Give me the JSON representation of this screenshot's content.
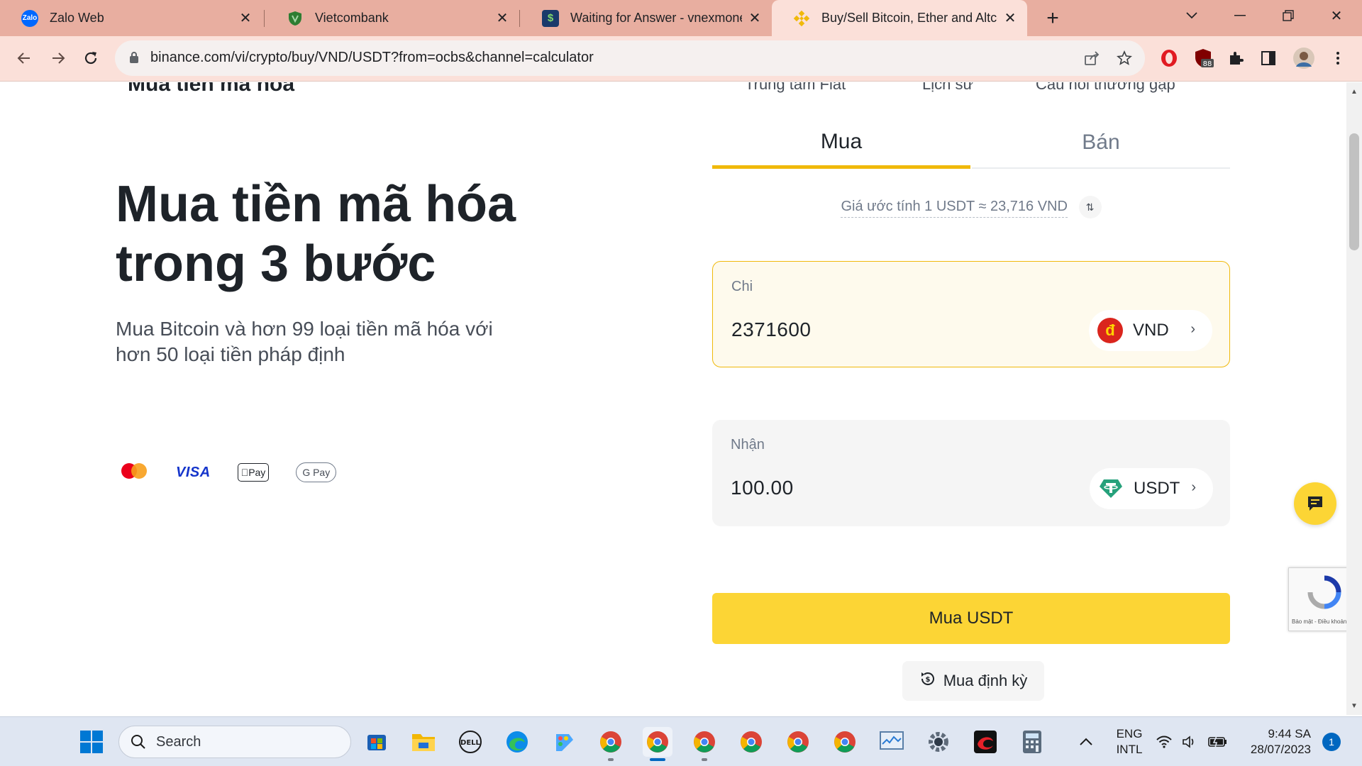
{
  "browser": {
    "tabs": [
      {
        "title": "Zalo Web",
        "favicon": "zalo-icon",
        "favicon_text": "Zalo",
        "color": "#0068ff"
      },
      {
        "title": "Vietcombank",
        "favicon": "shield-icon",
        "favicon_text": "",
        "color": "#2e7d32"
      },
      {
        "title": "Waiting for Answer - vnexmoney",
        "favicon": "dollar-icon",
        "favicon_text": "$",
        "color": "#1a3a6b"
      },
      {
        "title": "Buy/Sell Bitcoin, Ether and Altcoins",
        "favicon": "binance-icon",
        "favicon_text": "",
        "color": "#f0b90b"
      }
    ],
    "active_tab": 3,
    "url": "binance.com/vi/crypto/buy/VND/USDT?from=ocbs&channel=calculator",
    "extension_badge": "88"
  },
  "page": {
    "cut_title": "Mua tiền mã hóa",
    "cut_links": [
      "Trung tâm Fiat",
      "Lịch sử",
      "Câu hỏi thường gặp"
    ],
    "hero_title_line1": "Mua tiền mã hóa",
    "hero_title_line2": "trong 3 bước",
    "hero_sub_line1": "Mua Bitcoin và hơn 99 loại tiền mã hóa với",
    "hero_sub_line2": "hơn 50 loại tiền pháp định",
    "payments": {
      "visa": "VISA",
      "applepay": "Pay",
      "googlepay": "G Pay"
    },
    "tabs": {
      "buy": "Mua",
      "sell": "Bán"
    },
    "estimate": "Giá ước tính 1 USDT ≈ 23,716 VND",
    "spend": {
      "label": "Chi",
      "value": "2371600",
      "currency": "VND",
      "icon_text": "đ"
    },
    "receive": {
      "label": "Nhận",
      "value": "100.00",
      "currency": "USDT"
    },
    "buy_button": "Mua USDT",
    "recurring_button": "Mua định kỳ",
    "recaptcha_text": "Bảo mật - Điều khoản"
  },
  "taskbar": {
    "search_placeholder": "Search",
    "lang_line1": "ENG",
    "lang_line2": "INTL",
    "time": "9:44 SA",
    "date": "28/07/2023",
    "notifications": "1"
  },
  "colors": {
    "binance_yellow": "#fcd535",
    "binance_accent": "#f0b90b",
    "tabstrip": "#e8aea0",
    "toolbar": "#fbe0d9",
    "usdt_green": "#26a17b",
    "vnd_red": "#da251d"
  }
}
